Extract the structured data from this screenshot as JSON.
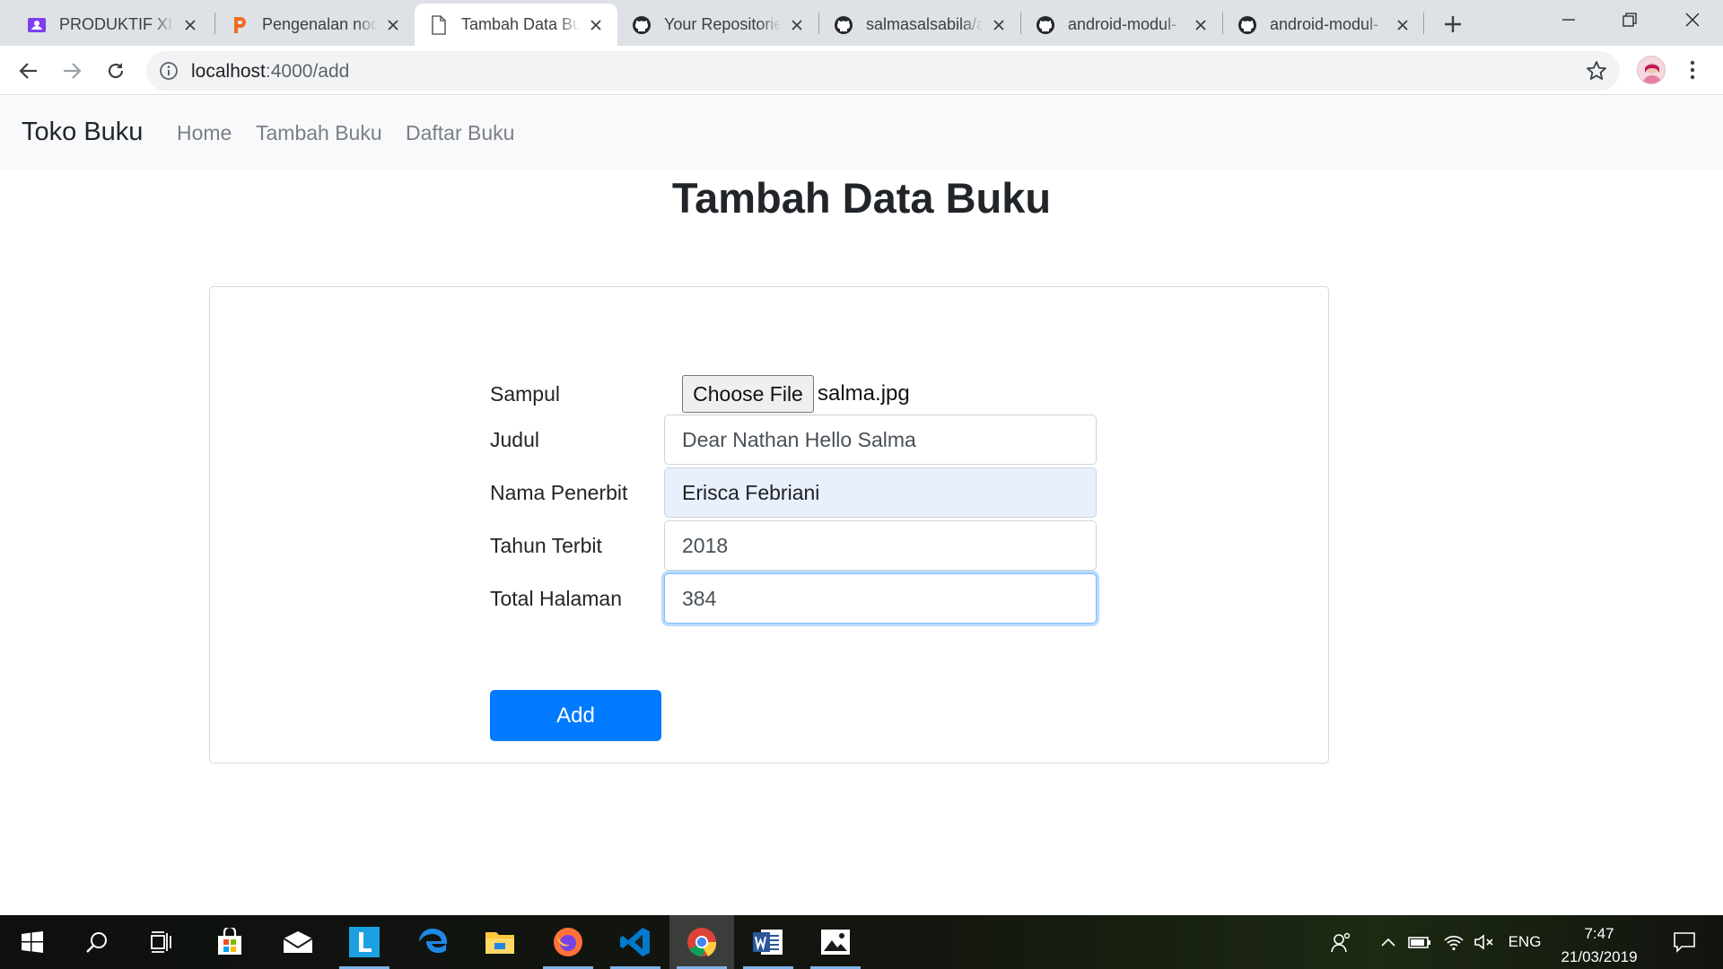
{
  "browser": {
    "tabs": [
      {
        "title": "PRODUKTIF XI R",
        "icon": "classroom-icon",
        "active": false
      },
      {
        "title": "Pengenalan nod",
        "icon": "p-letter-icon",
        "active": false
      },
      {
        "title": "Tambah Data Bu",
        "icon": "page-icon",
        "active": true
      },
      {
        "title": "Your Repositorie",
        "icon": "github-icon",
        "active": false
      },
      {
        "title": "salmasalsabila/a",
        "icon": "github-icon",
        "active": false
      },
      {
        "title": "android-modul-",
        "icon": "github-icon",
        "active": false
      },
      {
        "title": "android-modul-",
        "icon": "github-icon",
        "active": false
      }
    ],
    "address": {
      "host": "localhost",
      "path": ":4000/add"
    }
  },
  "navbar": {
    "brand": "Toko Buku",
    "links": [
      "Home",
      "Tambah Buku",
      "Daftar Buku"
    ]
  },
  "page": {
    "title": "Tambah Data Buku"
  },
  "form": {
    "cover_label": "Sampul",
    "file_button": "Choose File",
    "file_name": "salma.jpg",
    "fields": [
      {
        "label": "Judul",
        "value": "Dear Nathan Hello Salma",
        "state": "normal"
      },
      {
        "label": "Nama Penerbit",
        "value": "Erisca Febriani",
        "state": "autofill"
      },
      {
        "label": "Tahun Terbit",
        "value": "2018",
        "state": "normal"
      },
      {
        "label": "Total Halaman",
        "value": "384",
        "state": "focused"
      }
    ],
    "submit_label": "Add"
  },
  "taskbar": {
    "apps": [
      "windows-start-icon",
      "search-icon",
      "task-view-icon",
      "store-icon",
      "mail-icon",
      "l-app-icon",
      "edge-icon",
      "file-explorer-icon",
      "firefox-icon",
      "vscode-icon",
      "chrome-icon",
      "word-icon",
      "photos-icon"
    ],
    "language": "ENG",
    "time": "7:47",
    "date": "21/03/2019"
  },
  "colors": {
    "primary": "#007bff",
    "navbar_bg": "#f8f9fa",
    "autofill_bg": "#e8f0fe",
    "tabstrip_bg": "#dee1e6"
  }
}
